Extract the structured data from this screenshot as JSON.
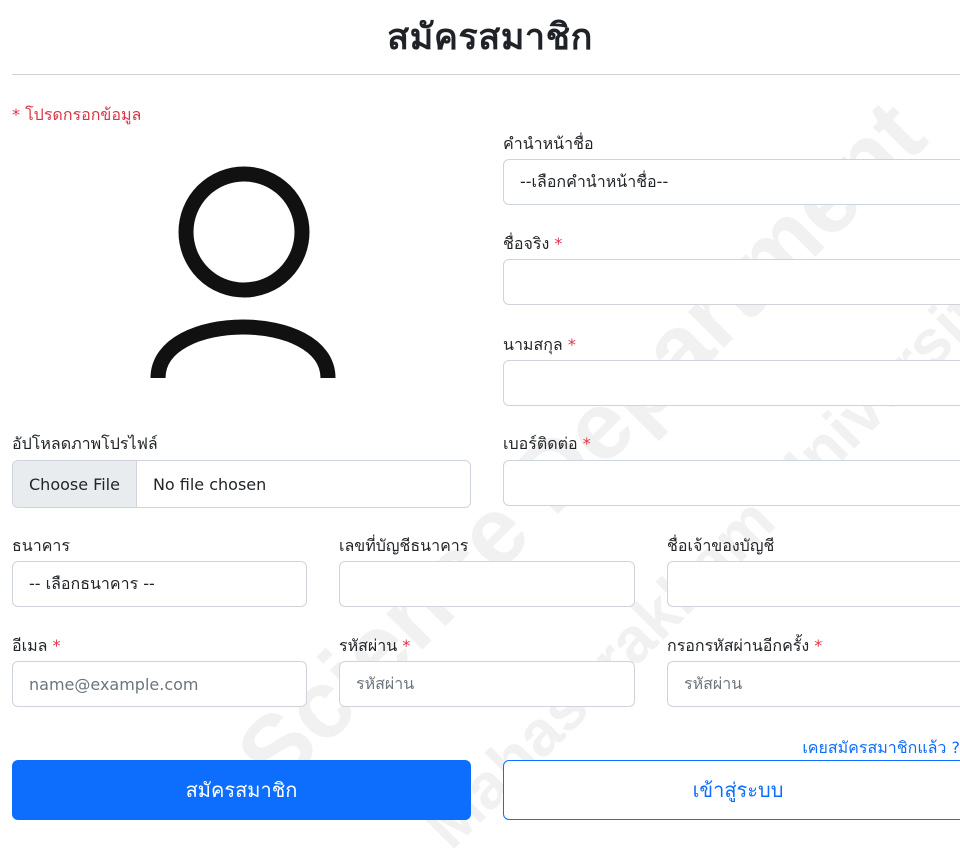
{
  "page": {
    "title": "สมัครสมาชิก",
    "required_note": "* โปรดกรอกข้อมูล"
  },
  "watermark": {
    "line1": "Science Department",
    "line2": "Mahasarakham University"
  },
  "form": {
    "prefix": {
      "label": "คำนำหน้าชื่อ",
      "value": "--เลือกคำนำหน้าชื่อ--"
    },
    "first_name": {
      "label": "ชื่อจริง",
      "required": "*",
      "value": ""
    },
    "last_name": {
      "label": "นามสกุล",
      "required": "*",
      "value": ""
    },
    "phone": {
      "label": "เบอร์ติดต่อ",
      "required": "*",
      "value": ""
    },
    "profile_upload": {
      "label": "อัปโหลดภาพโปรไฟล์",
      "button": "Choose File",
      "status": "No file chosen"
    },
    "bank": {
      "label": "ธนาคาร",
      "value": "-- เลือกธนาคาร --"
    },
    "account_number": {
      "label": "เลขที่บัญชีธนาคาร",
      "value": ""
    },
    "account_owner": {
      "label": "ชื่อเจ้าของบัญชี",
      "value": ""
    },
    "email": {
      "label": "อีเมล",
      "required": "*",
      "placeholder": "name@example.com"
    },
    "password": {
      "label": "รหัสผ่าน",
      "required": "*",
      "placeholder": "รหัสผ่าน"
    },
    "confirm_password": {
      "label": "กรอกรหัสผ่านอีกครั้ง",
      "required": "*",
      "placeholder": "รหัสผ่าน"
    }
  },
  "actions": {
    "already_member_link": "เคยสมัครสมาชิกแล้ว ?",
    "register_button": "สมัครสมาชิก",
    "login_button": "เข้าสู่ระบบ"
  },
  "icons": {
    "avatar": "user-icon"
  },
  "colors": {
    "primary": "#0d6efd",
    "required": "#dc3545",
    "border": "#ced4da"
  }
}
